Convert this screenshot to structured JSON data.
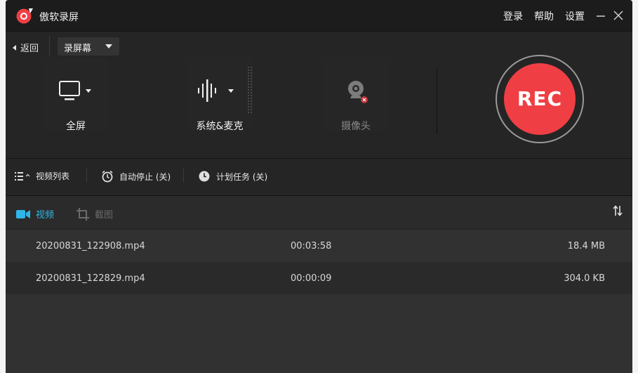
{
  "app": {
    "title": "傲软录屏"
  },
  "titlebar": {
    "login": "登录",
    "help": "帮助",
    "settings": "设置"
  },
  "controls": {
    "back_label": "返回",
    "mode": "录屏幕",
    "sources": [
      {
        "label": "全屏"
      },
      {
        "label": "系统&麦克"
      },
      {
        "label": "摄像头"
      }
    ],
    "rec_label": "REC"
  },
  "toolbar": {
    "video_list": "视频列表",
    "auto_stop": "自动停止 (关)",
    "schedule": "计划任务 (关)"
  },
  "tabs": {
    "video": "视频",
    "screenshot": "截图"
  },
  "files": [
    {
      "name": "20200831_122908.mp4",
      "duration": "00:03:58",
      "size": "18.4 MB"
    },
    {
      "name": "20200831_122829.mp4",
      "duration": "00:00:09",
      "size": "304.0 KB"
    }
  ],
  "colors": {
    "accent": "#2fb6e9",
    "rec": "#ef3f44",
    "background": "#252525"
  }
}
